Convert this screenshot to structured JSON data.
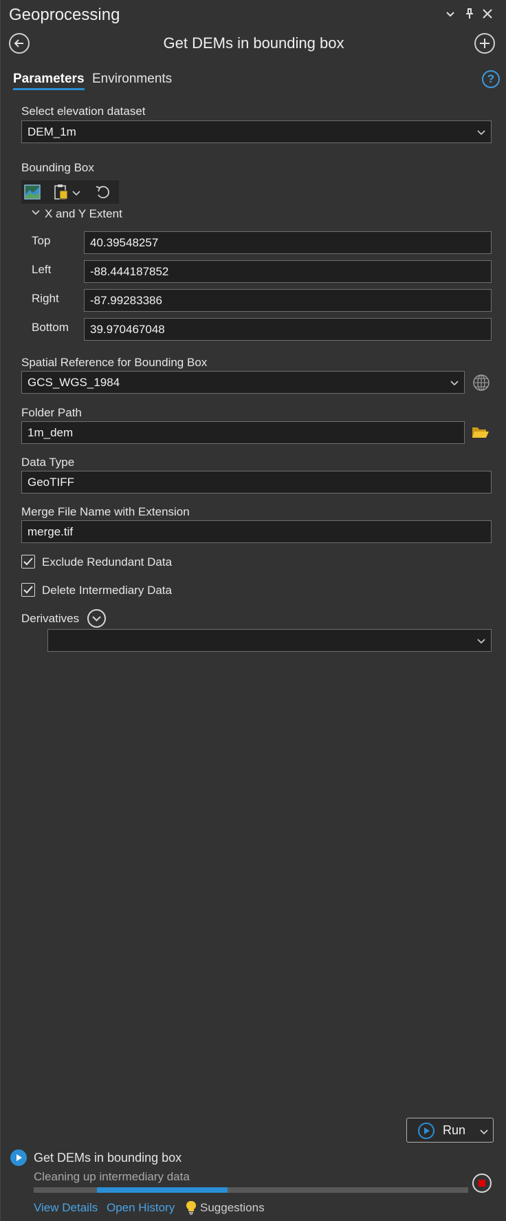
{
  "pane_title": "Geoprocessing",
  "tool_title": "Get DEMs in bounding box",
  "tabs": [
    {
      "label": "Parameters",
      "active": true
    },
    {
      "label": "Environments",
      "active": false
    }
  ],
  "help_label": "?",
  "params": {
    "elevation": {
      "label": "Select elevation dataset",
      "value": "DEM_1m"
    },
    "bbox": {
      "label": "Bounding Box",
      "extent_label": "X and Y Extent",
      "top": {
        "label": "Top",
        "value": "40.39548257"
      },
      "left": {
        "label": "Left",
        "value": "-88.444187852"
      },
      "right": {
        "label": "Right",
        "value": "-87.99283386"
      },
      "bottom": {
        "label": "Bottom",
        "value": "39.970467048"
      }
    },
    "spatial_ref": {
      "label": "Spatial Reference for Bounding Box",
      "value": "GCS_WGS_1984"
    },
    "folder": {
      "label": "Folder Path",
      "value": "1m_dem"
    },
    "data_type": {
      "label": "Data Type",
      "value": "GeoTIFF"
    },
    "merge_name": {
      "label": "Merge File Name with Extension",
      "value": "merge.tif"
    },
    "exclude_redundant": {
      "label": "Exclude Redundant Data",
      "checked": true
    },
    "delete_intermediary": {
      "label": "Delete Intermediary Data",
      "checked": true
    },
    "derivatives": {
      "label": "Derivatives",
      "value": ""
    }
  },
  "run_label": "Run",
  "status": {
    "tool_name": "Get DEMs in bounding box",
    "message": "Cleaning up intermediary data",
    "progress_start": 0.145,
    "progress_end": 0.445
  },
  "links": {
    "view_details": "View Details",
    "open_history": "Open History",
    "suggestions": "Suggestions"
  },
  "colors": {
    "accent": "#2b8fd6",
    "stop": "#e00000",
    "folder": "#e8b923"
  }
}
